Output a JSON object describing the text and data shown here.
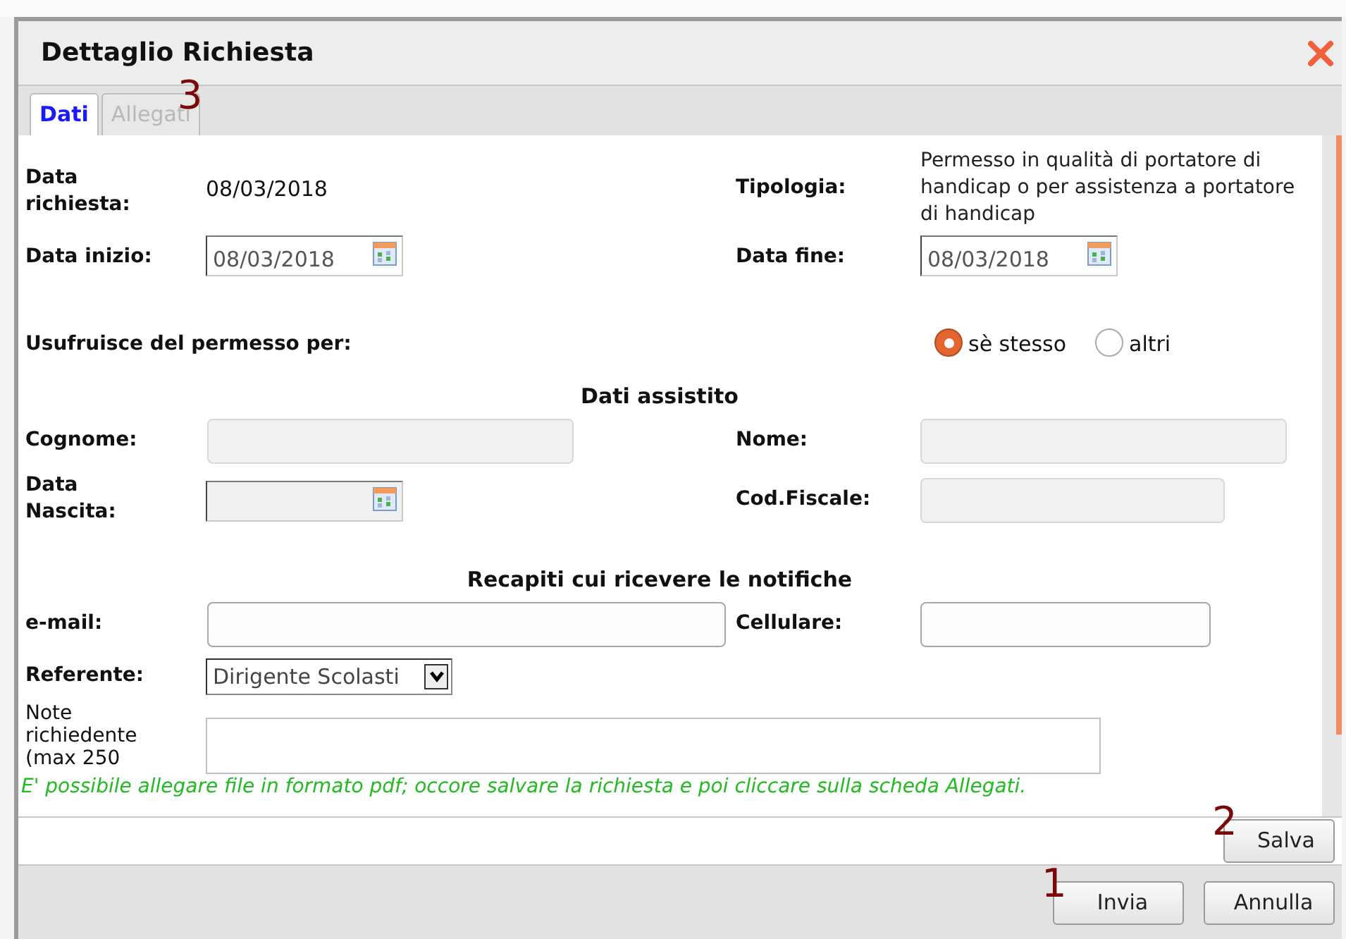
{
  "window": {
    "title": "Dettaglio Richiesta"
  },
  "tabs": [
    {
      "label": "Dati",
      "selected": true,
      "disabled": false
    },
    {
      "label": "Allegati",
      "selected": false,
      "disabled": true,
      "annotation": "3"
    }
  ],
  "request_date": {
    "label": "Data\nrichiesta:",
    "value": "08/03/2018"
  },
  "type": {
    "label": "Tipologia:",
    "value": "Permesso in qualità di portatore di handicap o per assistenza a portatore di handicap"
  },
  "start_date": {
    "label": "Data inizio:",
    "value": "08/03/2018"
  },
  "end_date": {
    "label": "Data fine:",
    "value": "08/03/2018"
  },
  "beneficiary": {
    "label": "Usufruisce del permesso per:",
    "options": [
      {
        "label": "sè stesso",
        "selected": true
      },
      {
        "label": "altri",
        "selected": false
      }
    ]
  },
  "assisted_heading": "Dati assistito",
  "surname": {
    "label": "Cognome:",
    "disabled": true
  },
  "name": {
    "label": "Nome:",
    "disabled": true
  },
  "birth_date": {
    "label": "Data\nNascita:",
    "disabled": true
  },
  "tax_code": {
    "label": "Cod.Fiscale:",
    "disabled": true
  },
  "contacts_heading": "Recapiti cui ricevere le notifiche",
  "email": {
    "label": "e-mail:",
    "disabled": false
  },
  "mobile": {
    "label": "Cellulare:",
    "disabled": false
  },
  "referent": {
    "label": "Referente:",
    "value": "Dirigente Scolasti"
  },
  "notes": {
    "label": "Note\nrichiedente\n(max 250"
  },
  "notice": "E' possibile allegare file in formato pdf; occore salvare la richiesta e poi cliccare sulla scheda Allegati.",
  "save_button": {
    "label": "Salva",
    "annotation": "2"
  },
  "footer_buttons": [
    {
      "label": "Invia",
      "annotation": "1"
    },
    {
      "label": "Annulla"
    }
  ]
}
